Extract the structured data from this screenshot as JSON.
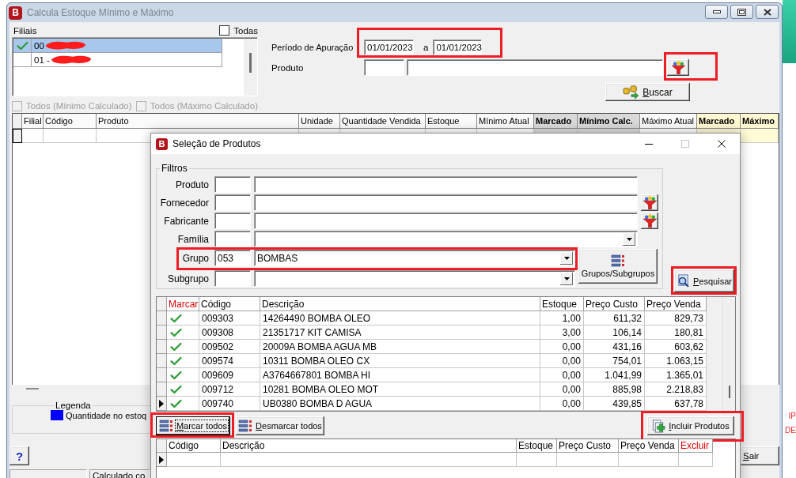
{
  "desktop": {
    "side_texts": [
      "IP",
      "DE"
    ]
  },
  "main_window": {
    "title": "Calcula Estoque Mínimo e Máximo",
    "icon_letter": "B",
    "active": false
  },
  "branches": {
    "label": "Filiais",
    "select_all": {
      "label": "Todas",
      "checked": false
    },
    "items": [
      {
        "code": "00",
        "checked": true,
        "selected": true,
        "redacted": true
      },
      {
        "code": "01 -",
        "checked": false,
        "selected": false,
        "redacted": true
      }
    ]
  },
  "calculated_filters": [
    {
      "label": "Todos (Mínimo Calculado)",
      "checked": false,
      "disabled": true
    },
    {
      "label": "Todos (Máximo Calculado)",
      "checked": false,
      "disabled": true
    }
  ],
  "period": {
    "label": "Período de Apuração",
    "from": "01/01/2023",
    "separator": "a",
    "to": "01/01/2023",
    "highlighted": true
  },
  "product": {
    "label": "Produto",
    "lookup_highlighted": true
  },
  "search_button": {
    "label": "Buscar"
  },
  "main_grid": {
    "columns": [
      {
        "label": "Filial",
        "kind": "plain"
      },
      {
        "label": "Código",
        "kind": "plain"
      },
      {
        "label": "Produto",
        "kind": "plain"
      },
      {
        "label": "Unidade",
        "kind": "plain"
      },
      {
        "label": "Quantidade Vendida",
        "kind": "plain"
      },
      {
        "label": "Estoque",
        "kind": "plain"
      },
      {
        "label": "Mínimo Atual",
        "kind": "plain"
      },
      {
        "label": "Marcado",
        "kind": "min_calc"
      },
      {
        "label": "Mínimo Calc.",
        "kind": "min_calc"
      },
      {
        "label": "Máximo Atual",
        "kind": "plain"
      },
      {
        "label": "Marcado",
        "kind": "max_calc"
      },
      {
        "label": "Máximo",
        "kind": "max_calc"
      }
    ]
  },
  "legend": {
    "title": "Legenda",
    "items": [
      {
        "label": "Quantidade no estoq",
        "color": "#0000ff"
      }
    ]
  },
  "help_button": {
    "label": "?"
  },
  "exit_button": {
    "label": "Sair"
  },
  "status_bar": {
    "text": "Calculado co"
  },
  "dialog": {
    "title": "Seleção de Produtos",
    "icon_letter": "B",
    "filters": {
      "title": "Filtros",
      "rows": [
        {
          "label": "Produto",
          "kind": "text",
          "highlighted": false
        },
        {
          "label": "Fornecedor",
          "kind": "lookup",
          "highlighted": false
        },
        {
          "label": "Fabricante",
          "kind": "lookup",
          "highlighted": false
        },
        {
          "label": "Família",
          "kind": "combo",
          "highlighted": false
        },
        {
          "label": "Grupo",
          "kind": "combo",
          "code": "053",
          "value": "BOMBAS",
          "highlighted": true
        },
        {
          "label": "Subgrupo",
          "kind": "combo",
          "highlighted": false
        }
      ]
    },
    "groups_button": {
      "label": "Grupos/Subgrupos"
    },
    "search_button": {
      "label": "Pesquisar",
      "highlighted": true
    },
    "products": {
      "mark_column": {
        "label": "Marcar"
      },
      "columns": [
        {
          "label": "Código",
          "kind": "text"
        },
        {
          "label": "Descrição",
          "kind": "text"
        },
        {
          "label": "Estoque",
          "kind": "number"
        },
        {
          "label": "Preço Custo",
          "kind": "number"
        },
        {
          "label": "Preço Venda",
          "kind": "number"
        }
      ],
      "rows": [
        {
          "marked": true,
          "current": false,
          "cells": [
            "009303",
            "14264490 BOMBA OLEO",
            "1,00",
            "611,32",
            "829,73"
          ]
        },
        {
          "marked": true,
          "current": false,
          "cells": [
            "009308",
            "21351717 KIT CAMISA",
            "3,00",
            "106,14",
            "180,81"
          ]
        },
        {
          "marked": true,
          "current": false,
          "cells": [
            "009502",
            "20009A BOMBA AGUA MB",
            "0,00",
            "431,16",
            "603,62"
          ]
        },
        {
          "marked": true,
          "current": false,
          "cells": [
            "009574",
            "10311 BOMBA OLEO CX",
            "0,00",
            "754,01",
            "1.063,15"
          ]
        },
        {
          "marked": true,
          "current": false,
          "cells": [
            "009609",
            "A3764667801 BOMBA HI",
            "0,00",
            "1.041,99",
            "1.365,01"
          ]
        },
        {
          "marked": true,
          "current": false,
          "cells": [
            "009712",
            "10281 BOMBA OLEO MOT",
            "0,00",
            "885,98",
            "2.218,83"
          ]
        },
        {
          "marked": true,
          "current": true,
          "cells": [
            "009740",
            "UB0380 BOMBA D AGUA",
            "0,00",
            "439,85",
            "637,78"
          ]
        }
      ]
    },
    "mark_all_button": {
      "label": "Marcar todos",
      "highlighted": true,
      "focused": true
    },
    "unmark_all_button": {
      "label": "Desmarcar todos",
      "highlighted": false,
      "focused": false
    },
    "include_button": {
      "label": "Incluir Produtos",
      "highlighted": true
    },
    "selected_products": {
      "columns": [
        {
          "label": "Código",
          "kind": "text"
        },
        {
          "label": "Descrição",
          "kind": "text"
        },
        {
          "label": "Estoque",
          "kind": "number"
        },
        {
          "label": "Preço Custo",
          "kind": "number"
        },
        {
          "label": "Preço Venda",
          "kind": "number"
        },
        {
          "label": "Excluir",
          "kind": "action"
        }
      ],
      "pointer_on_new_row": true
    }
  }
}
